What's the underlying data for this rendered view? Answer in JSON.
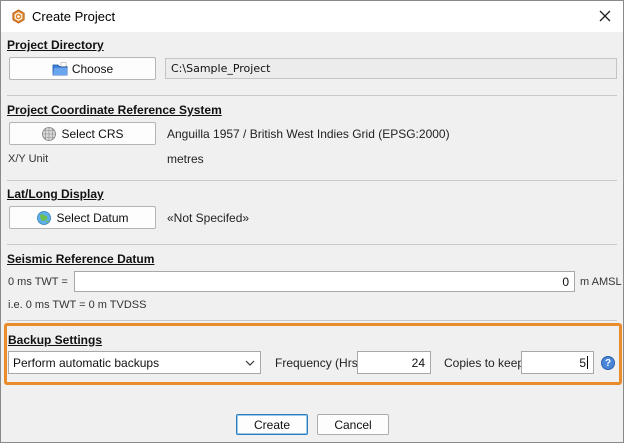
{
  "window": {
    "title": "Create Project"
  },
  "project_directory": {
    "heading": "Project Directory",
    "choose_label": "Choose",
    "path": "C:\\Sample_Project"
  },
  "crs": {
    "heading": "Project Coordinate Reference System",
    "select_label": "Select CRS",
    "value": "Anguilla 1957 / British West Indies Grid (EPSG:2000)",
    "xy_unit_label": "X/Y Unit",
    "xy_unit_value": "metres"
  },
  "latlong": {
    "heading": "Lat/Long Display",
    "select_label": "Select Datum",
    "value": "«Not Specifed»"
  },
  "seismic": {
    "heading": "Seismic Reference Datum",
    "twt_label": "0 ms TWT =",
    "twt_value": "0",
    "unit": "m AMSL",
    "note": "i.e. 0 ms TWT = 0 m TVDSS"
  },
  "backup": {
    "heading": "Backup Settings",
    "mode_selected": "Perform automatic backups",
    "frequency_label": "Frequency (Hrs)",
    "frequency_value": "24",
    "copies_label": "Copies to keep",
    "copies_value": "5",
    "help_glyph": "?",
    "highlight_color": "#ea8b2c"
  },
  "footer": {
    "create_label": "Create",
    "cancel_label": "Cancel"
  },
  "icons": {
    "app": "app-logo-icon",
    "close": "close-icon",
    "folder": "folder-icon",
    "crs": "globe-grid-icon",
    "datum": "globe-icon",
    "dropdown": "chevron-down-icon",
    "help": "help-icon"
  }
}
